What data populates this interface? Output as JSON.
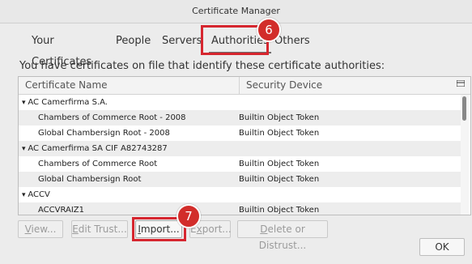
{
  "window": {
    "title": "Certificate Manager"
  },
  "tabs": [
    {
      "label": "Your Certificates"
    },
    {
      "label": "People"
    },
    {
      "label": "Servers"
    },
    {
      "label": "Authorities"
    },
    {
      "label": "Others"
    }
  ],
  "description": "You have certificates on file that identify these certificate authorities:",
  "table": {
    "columns": [
      "Certificate Name",
      "Security Device"
    ],
    "picker_icon": "column-picker-icon",
    "rows": [
      {
        "type": "group",
        "name": "AC Camerfirma S.A.",
        "device": ""
      },
      {
        "type": "item",
        "name": "Chambers of Commerce Root - 2008",
        "device": "Builtin Object Token"
      },
      {
        "type": "item",
        "name": "Global Chambersign Root - 2008",
        "device": "Builtin Object Token"
      },
      {
        "type": "group",
        "name": "AC Camerfirma SA CIF A82743287",
        "device": ""
      },
      {
        "type": "item",
        "name": "Chambers of Commerce Root",
        "device": "Builtin Object Token"
      },
      {
        "type": "item",
        "name": "Global Chambersign Root",
        "device": "Builtin Object Token"
      },
      {
        "type": "group",
        "name": "ACCV",
        "device": ""
      },
      {
        "type": "item",
        "name": "ACCVRAIZ1",
        "device": "Builtin Object Token"
      }
    ]
  },
  "buttons": {
    "view": {
      "mnemonic": "V",
      "rest": "iew..."
    },
    "edit_trust": {
      "mnemonic": "E",
      "rest": "dit Trust..."
    },
    "import": {
      "mnemonic": "I",
      "rest": "mport..."
    },
    "export": {
      "mnemonic": "x",
      "prefix": "E",
      "rest": "port..."
    },
    "delete": {
      "mnemonic": "D",
      "rest": "elete or Distrust..."
    },
    "ok": "OK"
  },
  "markers": {
    "step_tabs": "6",
    "step_import": "7"
  },
  "colors": {
    "highlight": "#d6262f",
    "marker": "#d22d2a"
  }
}
